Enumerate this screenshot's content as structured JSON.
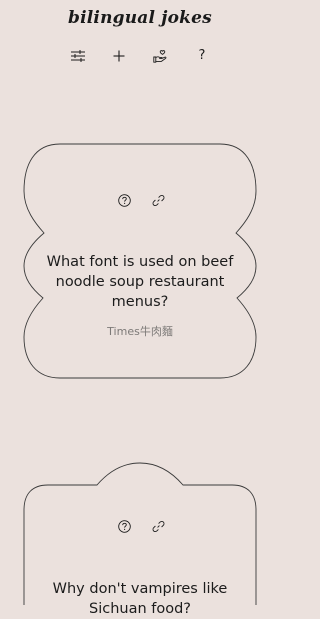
{
  "app": {
    "title": "bilingual jokes"
  },
  "toolbar": {
    "items": [
      {
        "icon": "sliders-icon"
      },
      {
        "icon": "plus-icon"
      },
      {
        "icon": "hand-heart-icon"
      },
      {
        "icon": "question-icon",
        "label": "?"
      }
    ]
  },
  "jokes": [
    {
      "question": "What font is used on beef noodle soup restaurant menus?",
      "answer": "Times牛肉麵"
    },
    {
      "question": "Why don't vampires like Sichuan food?",
      "answer": ""
    }
  ],
  "colors": {
    "background": "#ebe1dd",
    "ink": "#1c1c1c",
    "muted": "#7d7a78"
  }
}
